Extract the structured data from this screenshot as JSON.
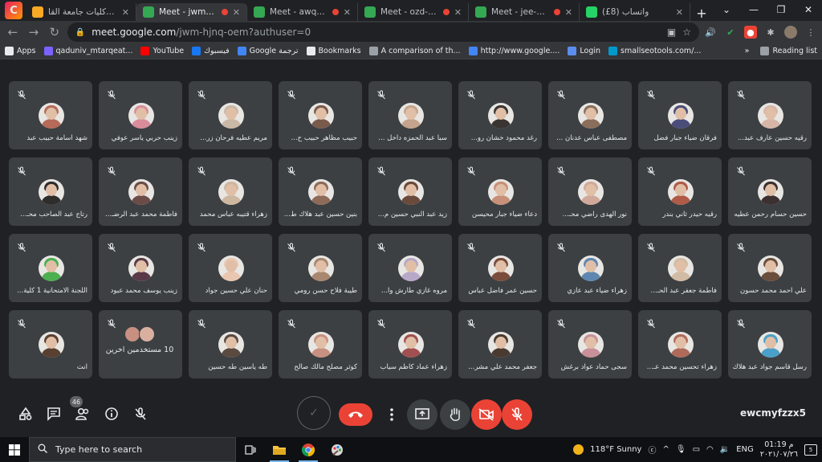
{
  "browser": {
    "tabs": [
      {
        "title": "جداول كليات جامعة القا",
        "favicon_color": "#f9a825",
        "recording": false,
        "active": false
      },
      {
        "title": "Meet - jwm-hjnq-",
        "favicon_color": "#34a853",
        "recording": true,
        "active": true
      },
      {
        "title": "Meet - awq-unwe",
        "favicon_color": "#34a853",
        "recording": true,
        "active": false
      },
      {
        "title": "Meet - ozd-fmfe-",
        "favicon_color": "#34a853",
        "recording": true,
        "active": false
      },
      {
        "title": "Meet - jee-kuav-",
        "favicon_color": "#34a853",
        "recording": true,
        "active": false
      },
      {
        "title": "(£8) واتساب",
        "favicon_color": "#25d366",
        "recording": false,
        "active": false
      }
    ],
    "url_host": "meet.google.com",
    "url_path": "/jwm-hjnq-oem?authuser=0",
    "bookmarks": [
      {
        "label": "Apps",
        "color": "#e8eaed"
      },
      {
        "label": "qaduniv_mtarqeat...",
        "color": "#7b61ff"
      },
      {
        "label": "YouTube",
        "color": "#ff0000"
      },
      {
        "label": "فيسبوك",
        "color": "#1877f2"
      },
      {
        "label": "Google ترجمة",
        "color": "#4285f4"
      },
      {
        "label": "Bookmarks",
        "color": "#e8eaed"
      },
      {
        "label": "A comparison of th...",
        "color": "#9aa0a6"
      },
      {
        "label": "http://www.google....",
        "color": "#4285f4"
      },
      {
        "label": "Login",
        "color": "#5b8def"
      },
      {
        "label": "smallseotools.com/...",
        "color": "#0099cc"
      }
    ],
    "reading_list": "Reading list"
  },
  "meet": {
    "participants": [
      {
        "name": "شهد اسامة حبيب عبد",
        "avatar": "#b56a5a"
      },
      {
        "name": "زينب حربي ياسر عوفي",
        "avatar": "#d98c9a"
      },
      {
        "name": "مريم عطيه فرحان زر...",
        "avatar": "#c9b8a6"
      },
      {
        "name": "حبيب مظاهر حبيب ح...",
        "avatar": "#7a5a4a"
      },
      {
        "name": "سبأ عبد الحمزه داخل ...",
        "avatar": "#c4a48c"
      },
      {
        "name": "رغد محمود خشان رو...",
        "avatar": "#3a3432"
      },
      {
        "name": "مصطفى عباس عدنان ...",
        "avatar": "#8a6e5c"
      },
      {
        "name": "فرقان ضياء جبار فضل",
        "avatar": "#4a4d7a"
      },
      {
        "name": "رقيه حسين عارف عبد...",
        "avatar": "#d7b6a8"
      },
      {
        "name": "رتاج عبد الصاحب محـ...",
        "avatar": "#2f2c2c"
      },
      {
        "name": "فاطمة محمد عبد الرضـ...",
        "avatar": "#6b4c48"
      },
      {
        "name": "زهراء قتيبه عباس محمد",
        "avatar": "#cdb7a1"
      },
      {
        "name": "بنين حسين عبد هلاك ط...",
        "avatar": "#8e6a58"
      },
      {
        "name": "زيد عبد النبي حسين م...",
        "avatar": "#6a4a3a"
      },
      {
        "name": "دعاء ضياء جبار محيسن",
        "avatar": "#c79078"
      },
      {
        "name": "نور الهدى راضي محـ...",
        "avatar": "#d0a99a"
      },
      {
        "name": "رقيه حيدر ثاني بندر",
        "avatar": "#b05a48"
      },
      {
        "name": "حسين حسام رحمن عطيه",
        "avatar": "#3d3030"
      },
      {
        "name": "اللجنة الامتحانية 1 كلية...",
        "avatar": "#4caf50"
      },
      {
        "name": "زينب يوسف محمد عبود",
        "avatar": "#5a3a48"
      },
      {
        "name": "حنان علي حسين جواد",
        "avatar": "#e8c6b0"
      },
      {
        "name": "طيبة فلاح حسن رومي",
        "avatar": "#a88870"
      },
      {
        "name": "مروه غازي طارش وا...",
        "avatar": "#b8a8c8"
      },
      {
        "name": "حسين عمر فاضل عباس",
        "avatar": "#7a4c3c"
      },
      {
        "name": "زهراء ضياء عبد عازي",
        "avatar": "#5d87b0"
      },
      {
        "name": "فاطمة جعفر عبد الحـ...",
        "avatar": "#d2bba4"
      },
      {
        "name": "علي احمد محمد حسون",
        "avatar": "#6b4e3c"
      },
      {
        "name": "انت",
        "avatar": "#5a4030"
      },
      {
        "name": "طه ياسين طه حسين",
        "avatar": "#5a4a40"
      },
      {
        "name": "كوثر مصلح مالك صالح",
        "avatar": "#c89080"
      },
      {
        "name": "زهراء عماد كاظم سياب",
        "avatar": "#a05050"
      },
      {
        "name": "جعفر محمد علي مشر...",
        "avatar": "#4a3a30"
      },
      {
        "name": "سجى حماد عواد برغش",
        "avatar": "#c89098"
      },
      {
        "name": "زهراء تحسين محمد عـ...",
        "avatar": "#b06a5a"
      },
      {
        "name": "رسل قاسم جواد عبد هلاك",
        "avatar": "#4aa0c8"
      }
    ],
    "others_tile": {
      "label": "10 مستخدمين آخرين",
      "avatar_a": "#c89080",
      "avatar_b": "#d9b0a0"
    },
    "participant_count": "46",
    "meeting_code": "ewcmyfzzx5",
    "colors": {
      "end_call": "#ea4335",
      "tile": "#3c4043",
      "background": "#202124"
    }
  },
  "taskbar": {
    "search_placeholder": "Type here to search",
    "weather": "118°F  Sunny",
    "language": "ENG",
    "time": "01:19 م",
    "date": "٢٠٢١/٠٧/٢٦",
    "notifications": "5"
  }
}
